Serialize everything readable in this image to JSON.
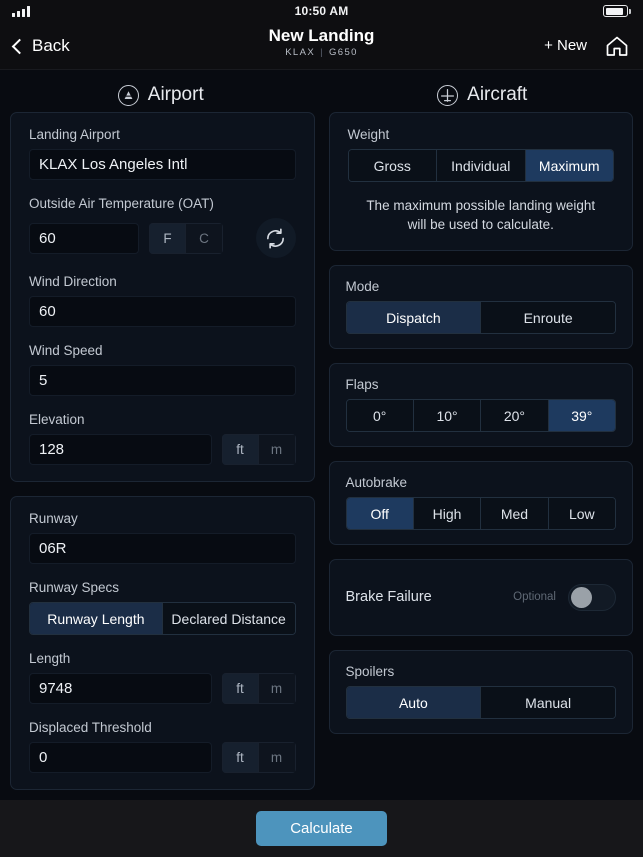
{
  "status_bar": {
    "time": "10:50 AM",
    "signal_icon": "signal-bars-icon",
    "battery_icon": "battery-icon"
  },
  "nav": {
    "back_label": "Back",
    "title": "New Landing",
    "subtitle_airport": "KLAX",
    "subtitle_divider": "|",
    "subtitle_aircraft": "G650",
    "new_label": "+ New",
    "home_icon": "home-icon"
  },
  "sections": {
    "airport": {
      "label": "Airport",
      "icon": "airport-tower-icon"
    },
    "aircraft": {
      "label": "Aircraft",
      "icon": "aircraft-icon"
    }
  },
  "airport": {
    "landing_airport": {
      "label": "Landing Airport",
      "value": "KLAX Los Angeles Intl",
      "placeholder": ""
    },
    "oat": {
      "label": "Outside Air Temperature (OAT)",
      "value": "60",
      "units": [
        "F",
        "C"
      ],
      "selected_unit": "F",
      "refresh_icon": "refresh-icon"
    },
    "wind_direction": {
      "label": "Wind Direction",
      "value": "60"
    },
    "wind_speed": {
      "label": "Wind Speed",
      "value": "5"
    },
    "elevation": {
      "label": "Elevation",
      "value": "128",
      "units": [
        "ft",
        "m"
      ],
      "selected_unit": "ft"
    },
    "runway": {
      "label": "Runway",
      "value": "06R"
    },
    "runway_specs": {
      "label": "Runway Specs",
      "options": [
        "Runway Length",
        "Declared Distance"
      ],
      "selected": "Runway Length"
    },
    "length": {
      "label": "Length",
      "value": "9748",
      "units": [
        "ft",
        "m"
      ],
      "selected_unit": "ft"
    },
    "displaced_threshold": {
      "label": "Displaced Threshold",
      "value": "0",
      "units": [
        "ft",
        "m"
      ],
      "selected_unit": "ft"
    }
  },
  "aircraft": {
    "weight": {
      "label": "Weight",
      "options": [
        "Gross",
        "Individual",
        "Maximum"
      ],
      "selected": "Maximum",
      "helper": "The maximum possible landing weight will be used to calculate."
    },
    "mode": {
      "label": "Mode",
      "options": [
        "Dispatch",
        "Enroute"
      ],
      "selected": "Dispatch"
    },
    "flaps": {
      "label": "Flaps",
      "options": [
        "0°",
        "10°",
        "20°",
        "39°"
      ],
      "selected": "39°"
    },
    "autobrake": {
      "label": "Autobrake",
      "options": [
        "Off",
        "High",
        "Med",
        "Low"
      ],
      "selected": "Off"
    },
    "brake_failure": {
      "label": "Brake Failure",
      "optional_tag": "Optional",
      "enabled": false
    },
    "spoilers": {
      "label": "Spoilers",
      "options": [
        "Auto",
        "Manual"
      ],
      "selected": "Auto"
    }
  },
  "footer": {
    "calculate_label": "Calculate"
  },
  "colors": {
    "accent": "#4d94bd",
    "selected_segment": "#1b2d47",
    "selected_segment_bright": "#1e3a5f",
    "card_bg": "#0c121c",
    "page_bg": "#080b11"
  }
}
